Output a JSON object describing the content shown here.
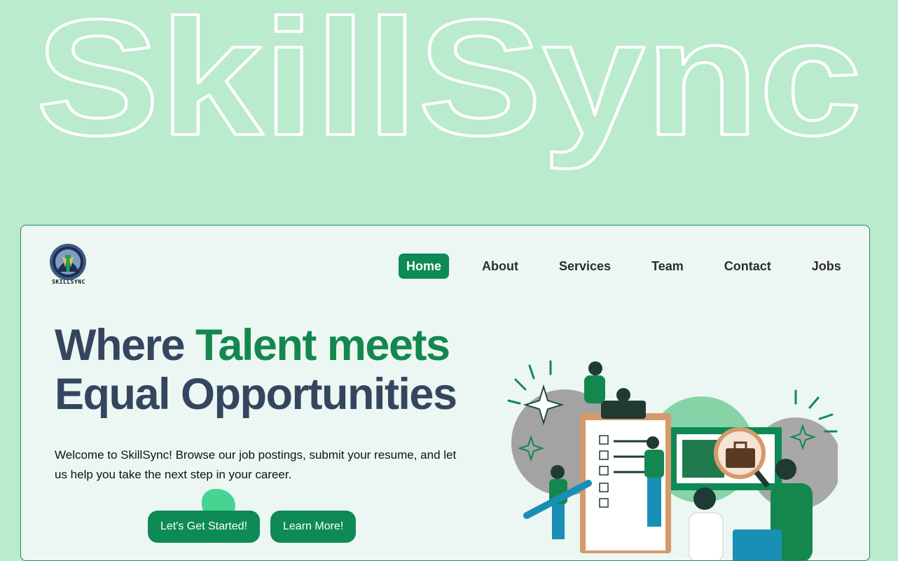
{
  "brand": {
    "wordmark": "SkillSync",
    "logo_text": "SKILLSYNC"
  },
  "nav": {
    "items": [
      {
        "label": "Home",
        "active": true
      },
      {
        "label": "About",
        "active": false
      },
      {
        "label": "Services",
        "active": false
      },
      {
        "label": "Team",
        "active": false
      },
      {
        "label": "Contact",
        "active": false
      },
      {
        "label": "Jobs",
        "active": false
      }
    ]
  },
  "hero": {
    "headline_part1": "Where ",
    "headline_accent": "Talent meets",
    "headline_line2": "Equal Opportunities",
    "intro": "Welcome to SkillSync! Browse our job postings, submit your resume, and let us help you take the next step in your career.",
    "primary_button": "Let's Get Started!",
    "secondary_button": "Learn More!"
  },
  "colors": {
    "background": "#b9ebcc",
    "card": "#ecf7f3",
    "accent": "#0e8a55",
    "headline": "#34465f"
  }
}
